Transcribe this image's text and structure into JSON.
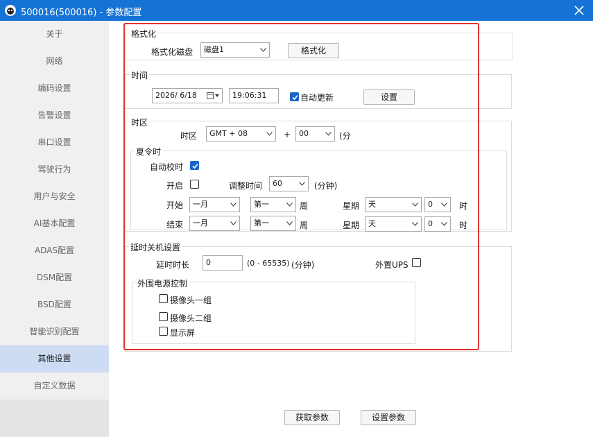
{
  "window": {
    "title": "500016(500016) - 参数配置",
    "close_icon": "close-icon"
  },
  "sidebar": {
    "items": [
      {
        "label": "关于"
      },
      {
        "label": "网络"
      },
      {
        "label": "编码设置"
      },
      {
        "label": "告警设置"
      },
      {
        "label": "串口设置"
      },
      {
        "label": "驾驶行为"
      },
      {
        "label": "用户与安全"
      },
      {
        "label": "AI基本配置"
      },
      {
        "label": "ADAS配置"
      },
      {
        "label": "DSM配置"
      },
      {
        "label": "BSD配置"
      },
      {
        "label": "智能识别配置"
      },
      {
        "label": "其他设置",
        "active": true
      },
      {
        "label": "自定义数据"
      }
    ]
  },
  "format": {
    "group_label": "格式化",
    "disk_label": "格式化磁盘",
    "disk_value": "磁盘1",
    "button": "格式化"
  },
  "time": {
    "group_label": "时间",
    "date_value": "2026/  6/18",
    "time_value": "19:06:31",
    "auto_update_label": "自动更新",
    "auto_update_checked": true,
    "set_button": "设置"
  },
  "timezone": {
    "group_label": "时区",
    "tz_label": "时区",
    "tz_value": "GMT + 08",
    "plus": "+",
    "minute_value": "00",
    "minute_unit": "(分",
    "dst": {
      "group_label": "夏令时",
      "auto_label": "自动校时",
      "auto_checked": true,
      "enable_label": "开启",
      "enable_checked": false,
      "adjust_label": "调整时间",
      "adjust_value": "60",
      "adjust_unit": "(分钟)",
      "start_label": "开始",
      "end_label": "结束",
      "start": {
        "month": "一月",
        "week": "第一",
        "week_unit": "周",
        "weekday_label": "星期",
        "weekday": "天",
        "hour": "0",
        "hour_unit": "时"
      },
      "end": {
        "month": "一月",
        "week": "第一",
        "week_unit": "周",
        "weekday_label": "星期",
        "weekday": "天",
        "hour": "0",
        "hour_unit": "时"
      }
    }
  },
  "shutdown": {
    "group_label": "延时关机设置",
    "delay_label": "延时时长",
    "delay_value": "0",
    "delay_range": "(0 - 65535)",
    "delay_unit": "(分钟)",
    "ups_label": "外置UPS",
    "ups_checked": false,
    "power": {
      "group_label": "外围电源控制",
      "items": [
        {
          "label": "摄像头一组",
          "checked": false
        },
        {
          "label": "摄像头二组",
          "checked": false
        },
        {
          "label": "显示屏",
          "checked": false
        }
      ]
    }
  },
  "footer": {
    "get_button": "获取参数",
    "set_button": "设置参数"
  },
  "colors": {
    "titlebar": "#1673d6",
    "highlight": "#e0312f",
    "active_item": "#cddcf3",
    "checkbox_on": "#1a66c9"
  }
}
